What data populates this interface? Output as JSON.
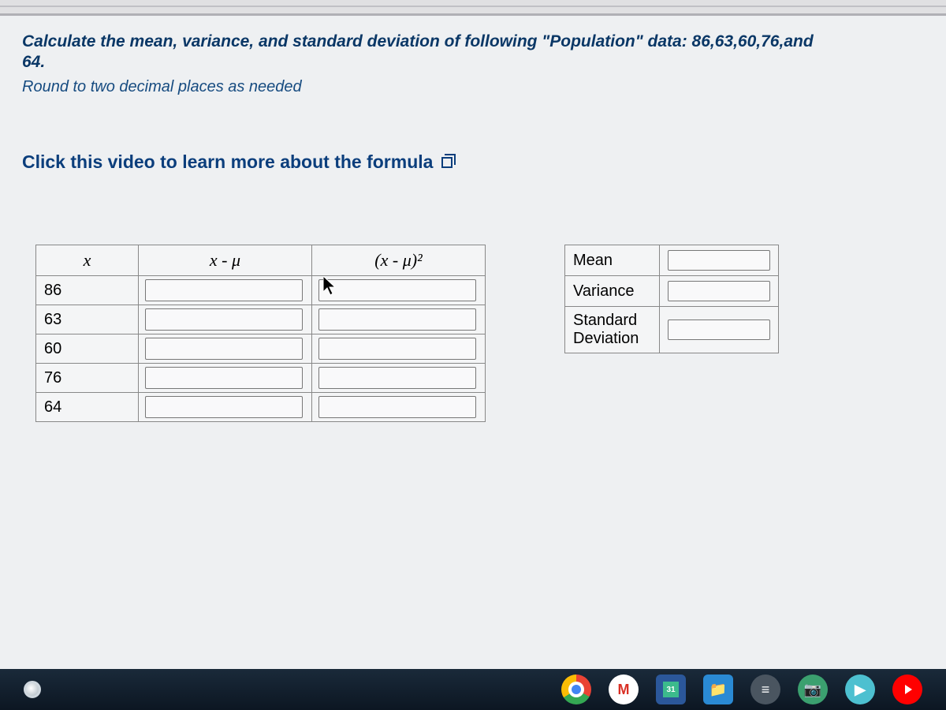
{
  "question": {
    "prompt_line1": "Calculate the mean, variance, and standard deviation of following \"Population\" data: 86,63,60,76,and",
    "prompt_line2": "64.",
    "round_note": "Round to two decimal places as needed"
  },
  "video_link": {
    "text": "Click this video to learn more about the formula"
  },
  "data_table": {
    "headers": {
      "x": "x",
      "x_minus_mu": "x - μ",
      "x_minus_mu_sq": "(x - μ)²"
    },
    "rows": [
      {
        "x": "86"
      },
      {
        "x": "63"
      },
      {
        "x": "60"
      },
      {
        "x": "76"
      },
      {
        "x": "64"
      }
    ]
  },
  "results_table": {
    "mean_label": "Mean",
    "variance_label": "Variance",
    "stddev_label": "Standard Deviation"
  },
  "taskbar": {
    "gmail_letter": "M",
    "word_badge": "31"
  }
}
